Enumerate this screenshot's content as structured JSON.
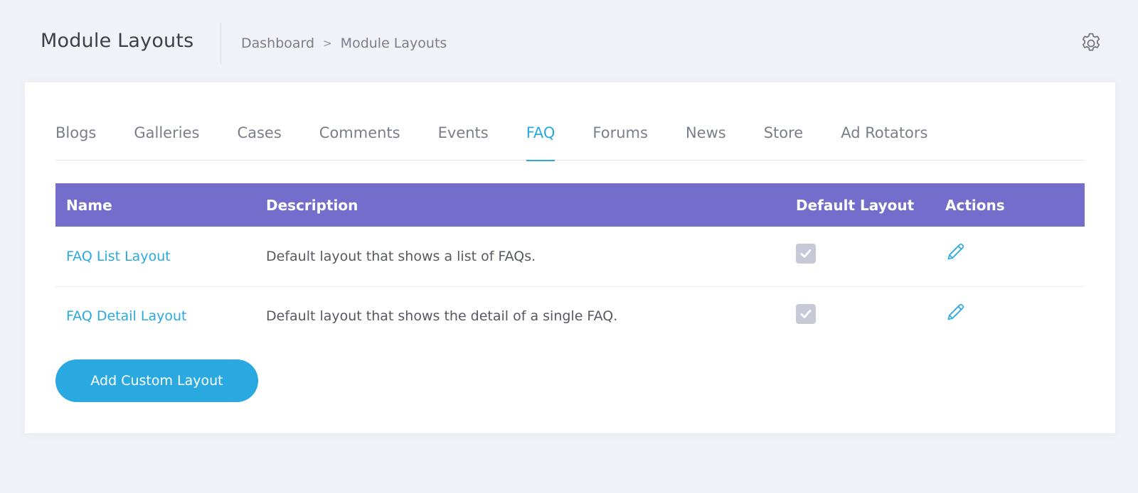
{
  "header": {
    "title": "Module Layouts",
    "breadcrumb": [
      "Dashboard",
      "Module Layouts"
    ],
    "breadcrumb_separator": ">",
    "settings_icon": "gear-icon"
  },
  "tabs": [
    {
      "label": "Blogs",
      "active": false
    },
    {
      "label": "Galleries",
      "active": false
    },
    {
      "label": "Cases",
      "active": false
    },
    {
      "label": "Comments",
      "active": false
    },
    {
      "label": "Events",
      "active": false
    },
    {
      "label": "FAQ",
      "active": true
    },
    {
      "label": "Forums",
      "active": false
    },
    {
      "label": "News",
      "active": false
    },
    {
      "label": "Store",
      "active": false
    },
    {
      "label": "Ad Rotators",
      "active": false
    }
  ],
  "table": {
    "columns": [
      "Name",
      "Description",
      "Default Layout",
      "Actions"
    ],
    "rows": [
      {
        "name": "FAQ List Layout",
        "description": "Default layout that shows a list of FAQs.",
        "default": true,
        "action_icon": "pencil-icon"
      },
      {
        "name": "FAQ Detail Layout",
        "description": "Default layout that shows the detail of a single FAQ.",
        "default": true,
        "action_icon": "pencil-icon"
      }
    ]
  },
  "actions": {
    "add_label": "Add Custom Layout"
  },
  "colors": {
    "accent": "#2aa9e0",
    "table_header": "#746dcb",
    "background": "#f1f2f7",
    "checkbox_disabled": "#c8c9d6"
  }
}
